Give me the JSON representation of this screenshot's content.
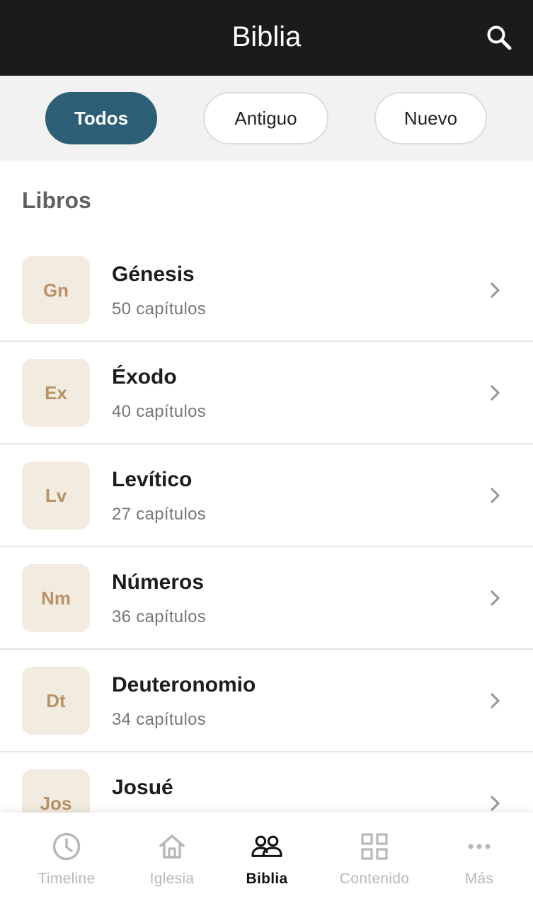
{
  "header": {
    "title": "Biblia",
    "search_icon": "search-icon"
  },
  "filters": [
    {
      "label": "Todos",
      "active": true
    },
    {
      "label": "Antiguo",
      "active": false
    },
    {
      "label": "Nuevo",
      "active": false
    }
  ],
  "section_title": "Libros",
  "books": [
    {
      "abbr": "Gn",
      "name": "Génesis",
      "chapters": "50 capítulos"
    },
    {
      "abbr": "Ex",
      "name": "Éxodo",
      "chapters": "40 capítulos"
    },
    {
      "abbr": "Lv",
      "name": "Levítico",
      "chapters": "27 capítulos"
    },
    {
      "abbr": "Nm",
      "name": "Números",
      "chapters": "36 capítulos"
    },
    {
      "abbr": "Dt",
      "name": "Deuteronomio",
      "chapters": "34 capítulos"
    },
    {
      "abbr": "Jos",
      "name": "Josué",
      "chapters": ""
    }
  ],
  "bottom_nav": [
    {
      "label": "Timeline",
      "icon": "clock-icon",
      "active": false
    },
    {
      "label": "Iglesia",
      "icon": "home-icon",
      "active": false
    },
    {
      "label": "Biblia",
      "icon": "people-icon",
      "active": true
    },
    {
      "label": "Contenido",
      "icon": "grid-icon",
      "active": false
    },
    {
      "label": "Más",
      "icon": "more-icon",
      "active": false
    }
  ],
  "colors": {
    "topbar": "#1b1b1b",
    "accent": "#2c5f75",
    "abbr_bg": "#f1ebe0",
    "abbr_text": "#b99266"
  }
}
